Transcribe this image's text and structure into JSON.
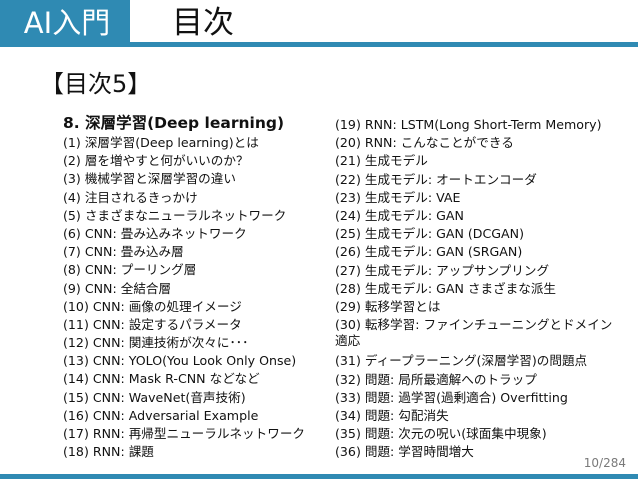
{
  "header": {
    "tab_label": "AI入門",
    "title": "目次"
  },
  "toc_heading": "【目次5】",
  "section_title": "8. 深層学習(Deep learning)",
  "left_items": [
    "(1) 深層学習(Deep learning)とは",
    "(2) 層を増やすと何がいいのか？",
    "(3) 機械学習と深層学習の違い",
    "(4) 注目されるきっかけ",
    "(5) さまざまなニューラルネットワーク",
    "(6) CNN: 畳み込みネットワーク",
    "(7) CNN: 畳み込み層",
    "(8) CNN: プーリング層",
    "(9) CNN:  全結合層",
    "(10) CNN: 画像の処理イメージ",
    "(11) CNN: 設定するパラメータ",
    "(12) CNN: 関連技術が次々に･･･",
    "(13) CNN: YOLO(You Look Only Onse)",
    "(14) CNN: Mask R-CNN などなど",
    "(15) CNN: WaveNet(音声技術)",
    "(16) CNN: Adversarial Example",
    "(17) RNN: 再帰型ニューラルネットワーク",
    "(18) RNN: 課題"
  ],
  "right_items": [
    "(19) RNN: LSTM(Long Short-Term Memory)",
    "(20) RNN: こんなことができる",
    "(21) 生成モデル",
    "(22) 生成モデル: オートエンコーダ",
    "(23) 生成モデル: VAE",
    "(24) 生成モデル: GAN",
    "(25) 生成モデル: GAN (DCGAN)",
    "(26) 生成モデル: GAN (SRGAN)",
    "(27) 生成モデル: アップサンプリング",
    "(28) 生成モデル: GAN さまざまな派生",
    "(29) 転移学習とは",
    "(30) 転移学習: ファインチューニングとドメイン適応",
    "(31) ディープラーニング(深層学習)の問題点",
    "(32) 問題: 局所最適解へのトラップ",
    "(33) 問題: 過学習(過剰適合) Overfitting",
    "(34) 問題: 勾配消失",
    "(35) 問題: 次元の呪い(球面集中現象)",
    "(36) 問題: 学習時間増大"
  ],
  "page_number": "10/284",
  "colors": {
    "accent": "#2f8ab3",
    "text": "#111111",
    "page_number": "#7a7a7a"
  }
}
